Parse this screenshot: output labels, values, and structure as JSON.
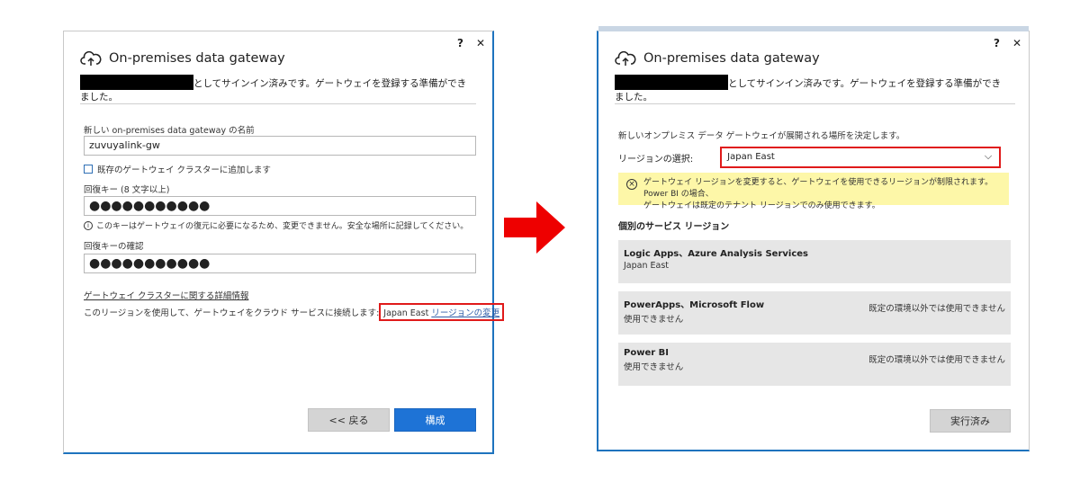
{
  "left_window": {
    "window_controls": {
      "help": "?",
      "close": "✕"
    },
    "title": "On-premises data gateway",
    "signin_text": "としてサインイン済みです。ゲートウェイを登録する準備ができました。",
    "name_label": "新しい on-premises data gateway の名前",
    "name_value": "zuvuyalink-gw",
    "add_cluster_label": "既存のゲートウェイ クラスターに追加します",
    "recovery_key_label": "回復キー (8 文字以上)",
    "recovery_key_value": "●●●●●●●●●●●",
    "recovery_info": "このキーはゲートウェイの復元に必要になるため、変更できません。安全な場所に記録してください。",
    "confirm_label": "回復キーの確認",
    "confirm_value": "●●●●●●●●●●●",
    "cluster_link": "ゲートウェイ クラスターに関する詳細情報",
    "region_text": "このリージョンを使用して、ゲートウェイをクラウド サービスに接続します:",
    "region_value": "Japan East",
    "region_change": "リージョンの変更",
    "back_button": "<< 戻る",
    "configure_button": "構成"
  },
  "right_window": {
    "window_controls": {
      "help": "?",
      "close": "✕"
    },
    "title": "On-premises data gateway",
    "signin_text": "としてサインイン済みです。ゲートウェイを登録する準備ができました。",
    "description": "新しいオンプレミス データ ゲートウェイが展開される場所を決定します。",
    "region_select_label": "リージョンの選択:",
    "region_selected": "Japan East",
    "warning_line1": "ゲートウェイ リージョンを変更すると、ゲートウェイを使用できるリージョンが制限されます。Power BI の場合、",
    "warning_line2": "ゲートウェイは既定のテナント リージョンでのみ使用できます。",
    "section_title": "個別のサービス リージョン",
    "services": [
      {
        "name": "Logic Apps、Azure Analysis Services",
        "value": "Japan East",
        "note": ""
      },
      {
        "name": "PowerApps、Microsoft Flow",
        "value": "使用できません",
        "note": "既定の環境以外では使用できません"
      },
      {
        "name": "Power BI",
        "value": "使用できません",
        "note": "既定の環境以外では使用できません"
      }
    ],
    "done_button": "実行済み"
  },
  "colors": {
    "accent_blue": "#1e73d6",
    "highlight_red": "#e01a1a",
    "warning_yellow": "#fdf7a8",
    "arrow_red": "#ee0000"
  },
  "icons": {
    "title_icon": "cloud-upload-icon",
    "transition": "arrow-right-icon"
  }
}
